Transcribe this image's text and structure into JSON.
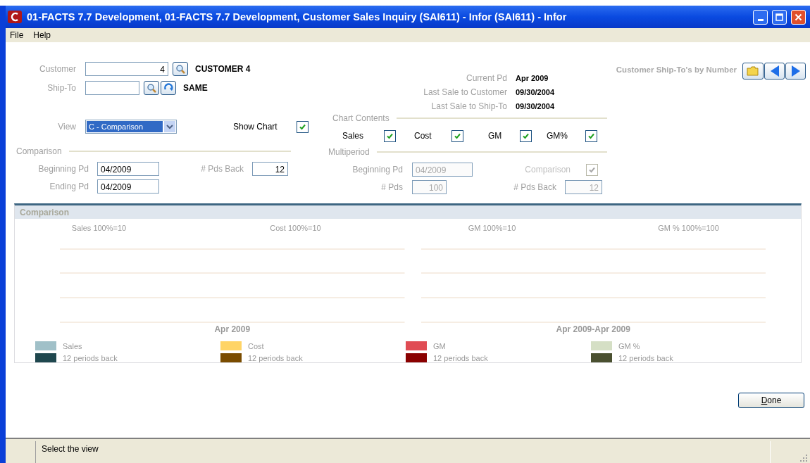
{
  "window": {
    "title": "01-FACTS 7.7 Development, 01-FACTS 7.7 Development, Customer Sales Inquiry (SAI611) - Infor (SAI611) - Infor"
  },
  "menu": [
    {
      "label": "File"
    },
    {
      "label": "Help"
    }
  ],
  "customer": {
    "label": "Customer",
    "value": "4",
    "name": "CUSTOMER 4"
  },
  "ship_to": {
    "label": "Ship-To",
    "name": "SAME"
  },
  "info": [
    {
      "label": "Current Pd",
      "value": "Apr 2009"
    },
    {
      "label": "Last Sale to Customer",
      "value": "09/30/2004"
    },
    {
      "label": "Last Sale to Ship-To",
      "value": "09/30/2004"
    }
  ],
  "lookup_title": "Customer Ship-To's by Number",
  "view": {
    "label": "View",
    "value": "C - Comparison"
  },
  "show_chart": {
    "label": "Show Chart",
    "checked": true
  },
  "chart_contents": {
    "title": "Chart Contents",
    "items": [
      {
        "label": "Sales",
        "checked": true
      },
      {
        "label": "Cost",
        "checked": true
      },
      {
        "label": "GM",
        "checked": true
      },
      {
        "label": "GM%",
        "checked": true
      }
    ]
  },
  "comparison": {
    "title": "Comparison",
    "beginning_pd": {
      "label": "Beginning Pd",
      "value": "04/2009",
      "disabled": false
    },
    "pds_back": {
      "label": "# Pds Back",
      "value": "12",
      "disabled": false
    },
    "ending_pd": {
      "label": "Ending Pd",
      "value": "04/2009",
      "disabled": false
    }
  },
  "multiperiod": {
    "title": "Multiperiod",
    "beginning_pd": {
      "label": "Beginning Pd",
      "value": "04/2009",
      "disabled": true
    },
    "comparison": {
      "label": "Comparison",
      "checked": true,
      "disabled": true
    },
    "pds": {
      "label": "# Pds",
      "value": "100",
      "disabled": true
    },
    "pds_back": {
      "label": "# Pds Back",
      "value": "12",
      "disabled": true
    }
  },
  "panel": {
    "title": "Comparison",
    "chart_titles": [
      "Sales 100%=10",
      "Cost 100%=10",
      "GM 100%=10",
      "GM % 100%=100"
    ],
    "periods": [
      "Apr 2009",
      "Apr 2009-Apr 2009"
    ],
    "legend": [
      [
        {
          "label": "Sales",
          "color": "#a0c0c8"
        },
        {
          "label": "12 periods back",
          "color": "#1f474e"
        }
      ],
      [
        {
          "label": "Cost",
          "color": "#ffd466"
        },
        {
          "label": "12 periods back",
          "color": "#7a4c00"
        }
      ],
      [
        {
          "label": "GM",
          "color": "#e04c54"
        },
        {
          "label": "12 periods back",
          "color": "#8a0000"
        }
      ],
      [
        {
          "label": "GM %",
          "color": "#d5dfc5"
        },
        {
          "label": "12 periods back",
          "color": "#4a5030"
        }
      ]
    ]
  },
  "done": "Done",
  "status": "Select the view"
}
